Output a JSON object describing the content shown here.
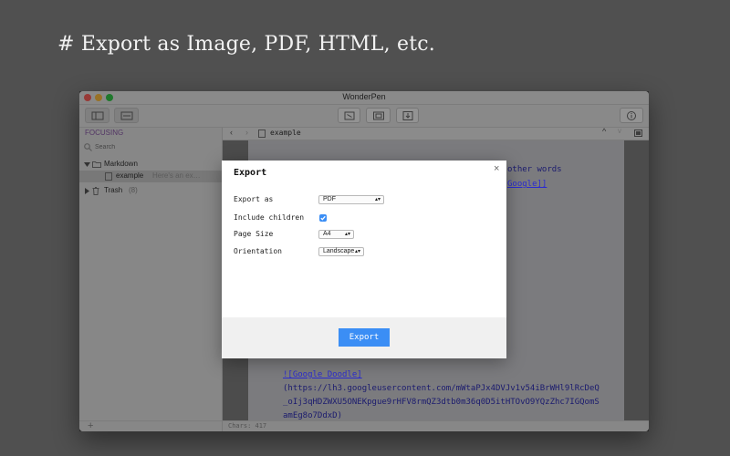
{
  "headline": "# Export as Image, PDF, HTML, etc.",
  "window": {
    "title": "WonderPen"
  },
  "colors": {
    "accent": "#3b8ef5",
    "focus_label": "#8a5aa8",
    "link": "#2b2bd0"
  },
  "toolbar": {
    "left_buttons": [
      "sidebar-toggle-icon",
      "layout-icon"
    ],
    "center_buttons": [
      "fullscreen-icon",
      "preview-icon",
      "export-icon"
    ],
    "right_buttons": [
      "info-icon"
    ]
  },
  "sidebar": {
    "heading": "FOCUSING",
    "search_placeholder": "Search",
    "tree": {
      "folder": "Markdown",
      "document": "example",
      "document_preview": "Here's an ex…",
      "trash": "Trash",
      "trash_count": "(8)"
    }
  },
  "editor": {
    "doc_name": "example",
    "lines_top": [
      "other words",
      "Google]]"
    ],
    "lines_bottom": [
      "![Google Doodle]",
      "(https://lh3.googleusercontent.com/mWtaPJx4DVJv1v54iBrWHl9lRcDeQ",
      "_oIj3qHDZWXU5ONEKpgue9rHFV8rmQZ3dtb0m36q0D5itHTOvO9YQzZhc7IGQomS",
      "amEg8o7DdxD)"
    ]
  },
  "status": {
    "chars": "Chars: 417"
  },
  "dialog": {
    "title": "Export",
    "close_glyph": "×",
    "fields": {
      "export_as_label": "Export as",
      "export_as_value": "PDF",
      "include_children_label": "Include children",
      "include_children_checked": true,
      "page_size_label": "Page Size",
      "page_size_value": "A4",
      "orientation_label": "Orientation",
      "orientation_value": "Landscape"
    },
    "export_button": "Export"
  }
}
